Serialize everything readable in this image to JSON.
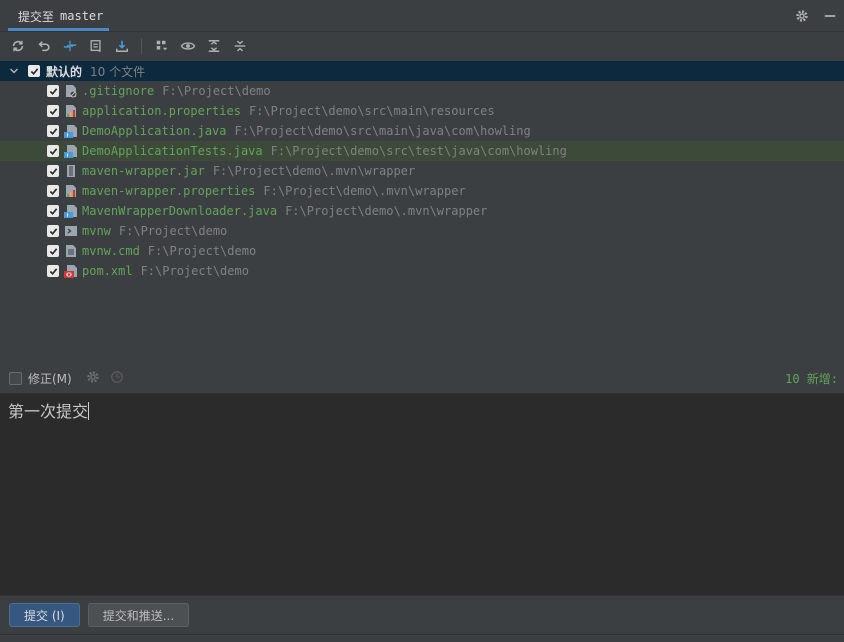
{
  "tab": {
    "label": "提交至",
    "branch": "master"
  },
  "group": {
    "name": "默认的",
    "count": "10 个文件"
  },
  "files": [
    {
      "name": ".gitignore",
      "path": "F:\\Project\\demo",
      "icon": "gitignore-file-icon"
    },
    {
      "name": "application.properties",
      "path": "F:\\Project\\demo\\src\\main\\resources",
      "icon": "properties-file-icon"
    },
    {
      "name": "DemoApplication.java",
      "path": "F:\\Project\\demo\\src\\main\\java\\com\\howling",
      "icon": "java-file-icon"
    },
    {
      "name": "DemoApplicationTests.java",
      "path": "F:\\Project\\demo\\src\\test\\java\\com\\howling",
      "icon": "java-file-icon"
    },
    {
      "name": "maven-wrapper.jar",
      "path": "F:\\Project\\demo\\.mvn\\wrapper",
      "icon": "jar-file-icon"
    },
    {
      "name": "maven-wrapper.properties",
      "path": "F:\\Project\\demo\\.mvn\\wrapper",
      "icon": "properties-file-icon"
    },
    {
      "name": "MavenWrapperDownloader.java",
      "path": "F:\\Project\\demo\\.mvn\\wrapper",
      "icon": "java-file-icon"
    },
    {
      "name": "mvnw",
      "path": "F:\\Project\\demo",
      "icon": "shell-script-icon"
    },
    {
      "name": "mvnw.cmd",
      "path": "F:\\Project\\demo",
      "icon": "text-file-icon"
    },
    {
      "name": "pom.xml",
      "path": "F:\\Project\\demo",
      "icon": "maven-pom-icon"
    }
  ],
  "amend": {
    "label": "修正(M)"
  },
  "stats": {
    "added": "10 新增:"
  },
  "commit_message": "第一次提交",
  "buttons": {
    "commit": "提交 (I)",
    "commit_push": "提交和推送..."
  },
  "colors": {
    "accent": "#4a88c7",
    "added_file": "#62a35a",
    "selection": "#0d293e"
  }
}
